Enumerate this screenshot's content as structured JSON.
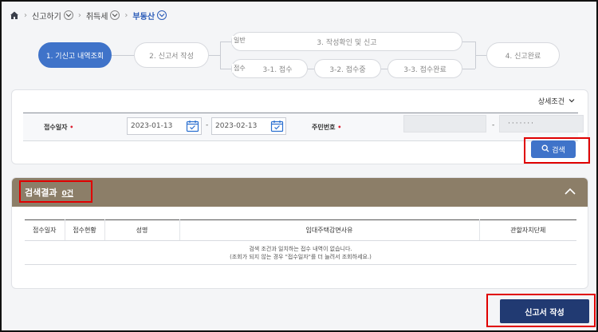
{
  "breadcrumb": {
    "items": [
      "신고하기",
      "취득세",
      "부동산"
    ]
  },
  "steps": {
    "s1": "1. 기신고 내역조회",
    "s2": "2. 신고서 작성",
    "s3": "3. 작성확인 및 신고",
    "tag_general": "일반",
    "tag_paper": "접수",
    "s31": "3-1. 접수",
    "s32": "3-2. 접수중",
    "s33": "3-3. 접수완료",
    "s4": "4. 신고완료"
  },
  "search": {
    "detail_label": "상세조건",
    "date_label": "접수일자",
    "date_from": "2023-01-13",
    "date_to": "2023-02-13",
    "tilde": "-",
    "jumin_label": "주민번호",
    "jumin_front": "",
    "jumin_back": "·······",
    "required_mark": "•",
    "button": "검색"
  },
  "results": {
    "title": "검색결과",
    "count": "0건",
    "columns": [
      "접수일자",
      "접수현황",
      "성명",
      "임대주택감면사유",
      "관할자치단체"
    ],
    "empty_line1": "검색 조건과 일치하는 접수 내역이 없습니다.",
    "empty_line2": "(조회가 되지 않는 경우 \"접수일자\"를 더 늘려서 조회하세요.)"
  },
  "actions": {
    "submit": "신고서 작성"
  },
  "colors": {
    "primary": "#3f73c9",
    "dark": "#213a72",
    "result_header": "#8c7e68",
    "highlight": "#e00000"
  }
}
